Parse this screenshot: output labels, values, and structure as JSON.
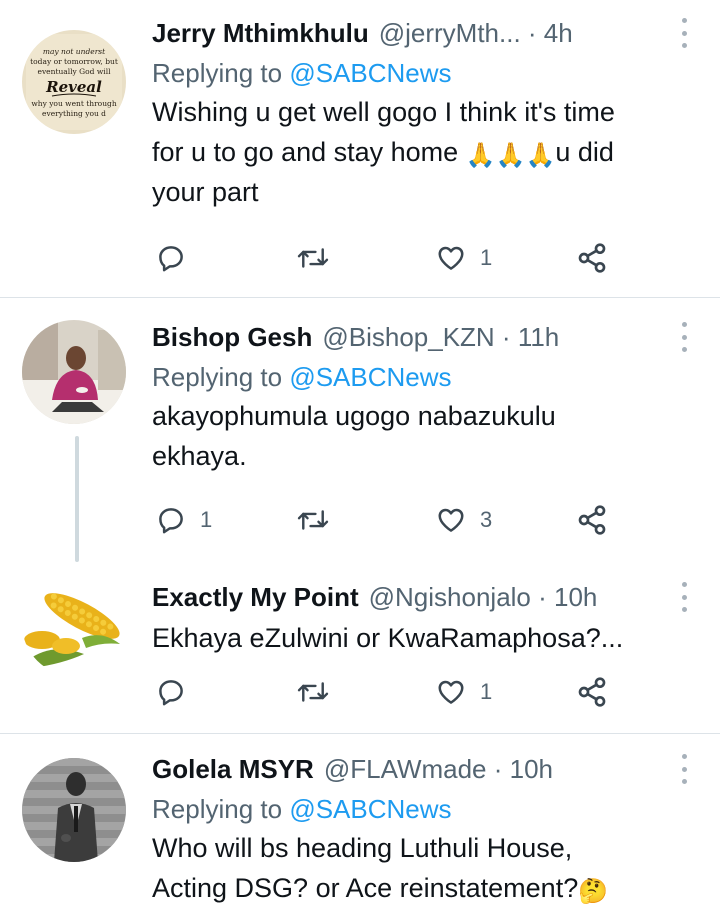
{
  "tweets": [
    {
      "name": "Jerry Mthimkhulu",
      "handle_time": "@jerryMth...   · 4h",
      "replying_prefix": "Replying to ",
      "replying_to": "@SABCNews",
      "text_line1": "Wishing u get well gogo I think it's time",
      "text_line2a": "for u to go and stay home ",
      "text_line2b": "u did",
      "text_line3": "your part",
      "emoji": "🙏🙏🙏",
      "reply_count": "",
      "like_count": "1",
      "avatar_text": {
        "l1": "may not underst",
        "l2": "today or tomorrow, but",
        "l3": "eventually God will",
        "l4": "Reveal",
        "l5": "why you went through",
        "l6": "everything you d"
      }
    },
    {
      "name": "Bishop Gesh",
      "handle_time": "@Bishop_KZN · 11h",
      "replying_prefix": "Replying to ",
      "replying_to": "@SABCNews",
      "text_line1": "akayophumula ugogo nabazukulu",
      "text_line2": "ekhaya.",
      "reply_count": "1",
      "like_count": "3"
    },
    {
      "name": "Exactly My Point",
      "handle_time": "@Ngishonjalo · 10h",
      "text_line1": "Ekhaya eZulwini or KwaRamaphosa?...",
      "reply_count": "",
      "like_count": "1"
    },
    {
      "name": "Golela MSYR",
      "handle_time": "@FLAWmade · 10h",
      "replying_prefix": "Replying to ",
      "replying_to": "@SABCNews",
      "text_line1": "Who will bs heading Luthuli House,",
      "text_line2": "Acting DSG? or Ace reinstatement?",
      "emoji": "🤔"
    }
  ],
  "icons": {
    "reply": "reply-icon",
    "retweet": "retweet-icon",
    "like": "heart-icon",
    "share": "share-icon",
    "more": "more-icon"
  },
  "colors": {
    "text": "#0f1419",
    "secondary": "#536471",
    "link": "#1d9bf0",
    "divider": "#dde3e8"
  }
}
